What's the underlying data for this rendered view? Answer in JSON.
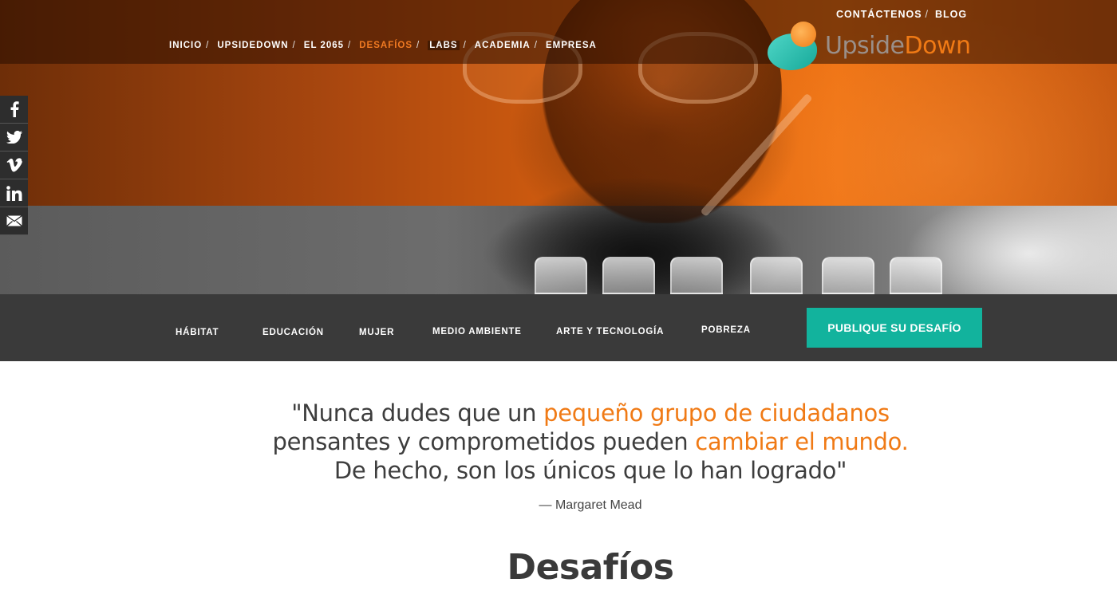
{
  "header": {
    "top_links": [
      "CONTÁCTENOS",
      "BLOG"
    ],
    "nav": [
      "INICIO",
      "UPSIDEDOWN",
      "EL 2065",
      "DESAFÍOS",
      "LABS",
      "ACADEMIA",
      "EMPRESA"
    ],
    "active_nav": "DESAFÍOS",
    "separator": "/",
    "logo": {
      "part1": "Upside",
      "part2": "Down"
    }
  },
  "social": [
    "facebook-icon",
    "twitter-icon",
    "vimeo-icon",
    "linkedin-icon",
    "email-icon"
  ],
  "categories": {
    "items": [
      "HÁBITAT",
      "EDUCACIÓN",
      "MUJER",
      "MEDIO AMBIENTE",
      "ARTE Y TECNOLOGÍA",
      "POBREZA"
    ],
    "cta": "PUBLIQUE SU DESAFÍO"
  },
  "quote": {
    "p1": "\"Nunca dudes que un ",
    "h1": "pequeño grupo de ciudadanos",
    "p2": "pensantes y comprometidos pueden ",
    "h2": "cambiar el mundo.",
    "p3": "De hecho, son los únicos que lo han logrado\"",
    "author": "— Margaret Mead"
  },
  "section_title": "Desafíos",
  "colors": {
    "accent_orange": "#f07a15",
    "cta_teal": "#12b39d",
    "dark_bar": "#3a3a3a"
  }
}
